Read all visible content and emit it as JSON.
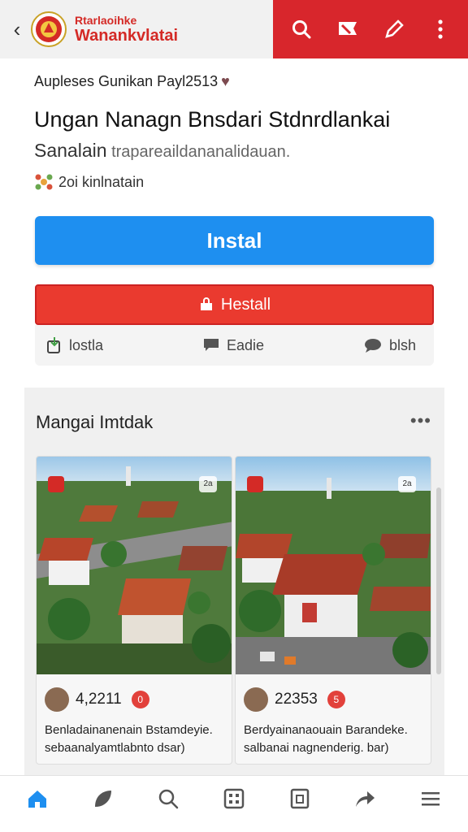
{
  "header": {
    "brand_top": "Rtarlaoihke",
    "brand_bottom": "Wanankvlatai"
  },
  "post": {
    "meta": "Aupleses Gunikan Payl2513",
    "title": "Ungan Nanagn Bnsdari Stdnrdlankai",
    "subtitle_main": "Sanalain",
    "subtitle_muted": " trapareaildananalidauan.",
    "rating_text": "2oi kinlnatain"
  },
  "buttons": {
    "install_label": "Instal",
    "red_label": "Hestall"
  },
  "actions": [
    {
      "label": "lostla"
    },
    {
      "label": "Eadie"
    },
    {
      "label": "blsh"
    }
  ],
  "section": {
    "title": "Mangai Imtdak",
    "more": "•••"
  },
  "cards": [
    {
      "count": "4,2211",
      "badge": "0",
      "badge_img": "2a",
      "desc": "Benladainanenain Bstamdeyie. sebaanalyamtlabnto dsar)"
    },
    {
      "count": "22353",
      "badge": "5",
      "badge_img": "2a",
      "desc": "Berdyainanaouain Barandeke. salbanai nagnenderig. bar)"
    }
  ],
  "nav": [
    {
      "icon": "home-icon"
    },
    {
      "icon": "leaf-icon"
    },
    {
      "icon": "search-icon"
    },
    {
      "icon": "grid-icon"
    },
    {
      "icon": "document-icon"
    },
    {
      "icon": "share-icon"
    },
    {
      "icon": "menu-icon"
    }
  ],
  "colors": {
    "brand_red": "#d8262c",
    "install_blue": "#1e8ff0",
    "button_red": "#ea3a2f",
    "active_nav": "#1e8ff0"
  }
}
